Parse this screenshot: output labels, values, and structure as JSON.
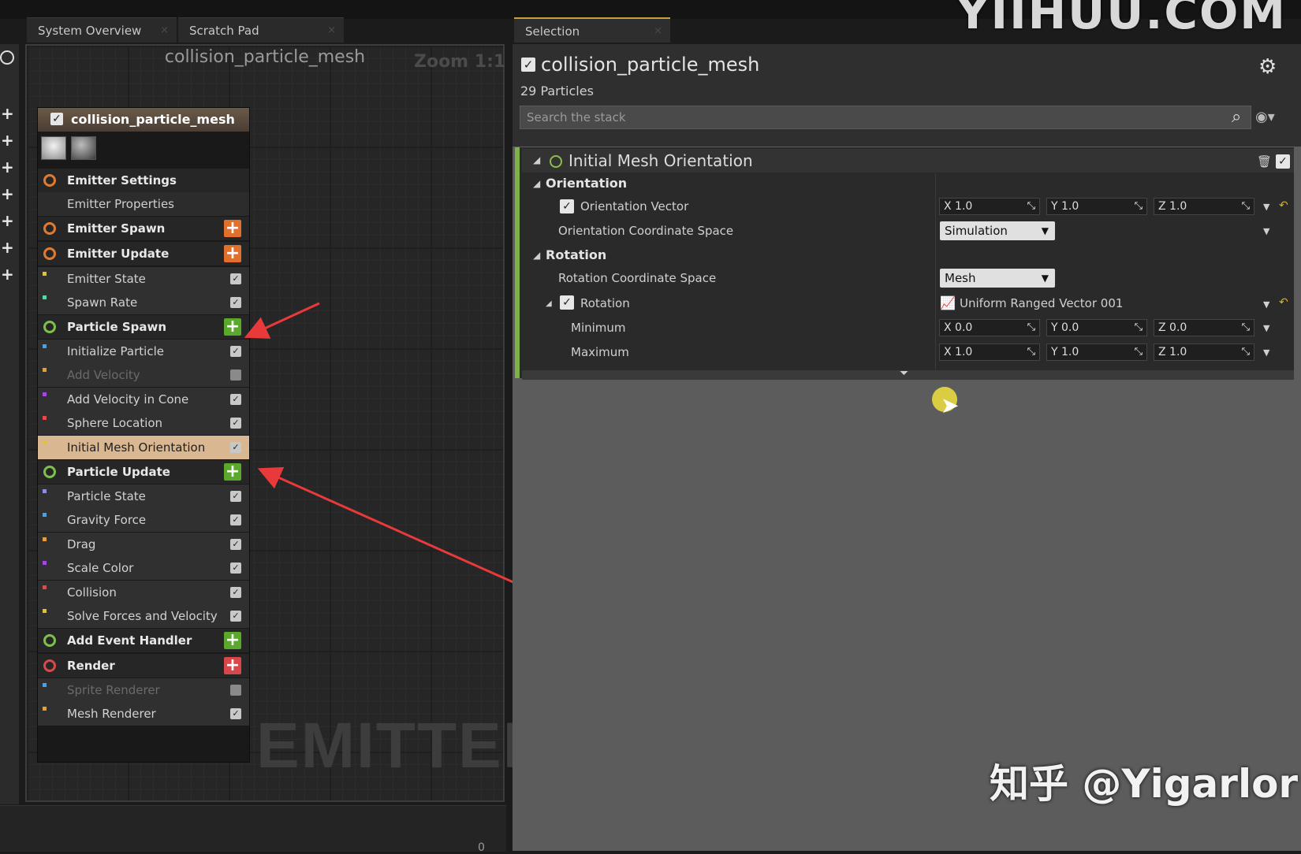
{
  "watermark_top": "YIIHUU.COM",
  "watermark_bottom": "知乎 @Yigarlor",
  "tabs": [
    {
      "label": "System Overview"
    },
    {
      "label": "Scratch Pad"
    },
    {
      "label": "Selection"
    }
  ],
  "tab_close_glyph": "×",
  "graph": {
    "title": "collision_particle_mesh",
    "zoom": "Zoom 1:1",
    "emitter_label": "EMITTER",
    "bottom_value": "0"
  },
  "node": {
    "title": "collision_particle_mesh",
    "rows": [
      {
        "label": "Emitter Settings",
        "kind": "stage",
        "icon_color": "#e07a30"
      },
      {
        "label": "Emitter Properties",
        "kind": "sub"
      },
      {
        "label": "Emitter Spawn",
        "kind": "stage",
        "icon_color": "#e07a30",
        "add_color": "#e0702c"
      },
      {
        "label": "Emitter Update",
        "kind": "stage",
        "icon_color": "#e07a30",
        "add_color": "#e0702c"
      },
      {
        "label": "Emitter State",
        "kind": "mod",
        "enabled": true
      },
      {
        "label": "Spawn Rate",
        "kind": "mod",
        "enabled": true
      },
      {
        "label": "Particle Spawn",
        "kind": "stage",
        "icon_color": "#7cc04a",
        "add_color": "#5aa82c"
      },
      {
        "label": "Initialize Particle",
        "kind": "mod",
        "enabled": true
      },
      {
        "label": "Add Velocity",
        "kind": "mod",
        "enabled": false
      },
      {
        "label": "Add Velocity in Cone",
        "kind": "mod",
        "enabled": true
      },
      {
        "label": "Sphere Location",
        "kind": "mod",
        "enabled": true
      },
      {
        "label": "Initial Mesh Orientation",
        "kind": "mod",
        "enabled": true,
        "selected": true
      },
      {
        "label": "Particle Update",
        "kind": "stage",
        "icon_color": "#7cc04a",
        "add_color": "#5aa82c"
      },
      {
        "label": "Particle State",
        "kind": "mod",
        "enabled": true
      },
      {
        "label": "Gravity Force",
        "kind": "mod",
        "enabled": true
      },
      {
        "label": "Drag",
        "kind": "mod",
        "enabled": true
      },
      {
        "label": "Scale Color",
        "kind": "mod",
        "enabled": true
      },
      {
        "label": "Collision",
        "kind": "mod",
        "enabled": true
      },
      {
        "label": "Solve Forces and Velocity",
        "kind": "mod",
        "enabled": true
      },
      {
        "label": "Add Event Handler",
        "kind": "stage",
        "icon_color": "#7cc04a",
        "add_color": "#5aa82c"
      },
      {
        "label": "Render",
        "kind": "stage",
        "icon_color": "#d84a4a",
        "add_color": "#d8484a"
      },
      {
        "label": "Sprite Renderer",
        "kind": "mod",
        "enabled": false
      },
      {
        "label": "Mesh Renderer",
        "kind": "mod",
        "enabled": true
      }
    ]
  },
  "selection": {
    "title": "collision_particle_mesh",
    "particles": "29 Particles",
    "search_placeholder": "Search the stack",
    "module": {
      "title": "Initial Mesh Orientation",
      "sections": {
        "orientation": "Orientation",
        "rotation": "Rotation"
      },
      "orientation_vector": {
        "label": "Orientation Vector",
        "x": "X 1.0",
        "y": "Y 1.0",
        "z": "Z 1.0"
      },
      "orientation_space": {
        "label": "Orientation Coordinate Space",
        "value": "Simulation"
      },
      "rotation_space": {
        "label": "Rotation Coordinate Space",
        "value": "Mesh"
      },
      "rotation": {
        "label": "Rotation",
        "value": "Uniform Ranged Vector 001"
      },
      "minimum": {
        "label": "Minimum",
        "x": "X 0.0",
        "y": "Y 0.0",
        "z": "Z 0.0"
      },
      "maximum": {
        "label": "Maximum",
        "x": "X 1.0",
        "y": "Y 1.0",
        "z": "Z 1.0"
      }
    }
  }
}
